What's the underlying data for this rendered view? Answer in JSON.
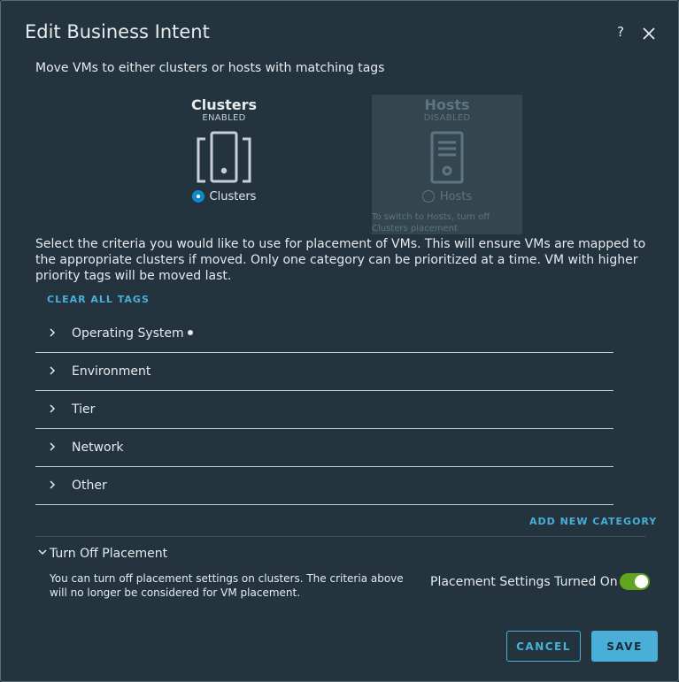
{
  "dialog": {
    "title": "Edit Business Intent",
    "help_label": "?",
    "subtitle": "Move VMs to either clusters or hosts with matching tags"
  },
  "options": {
    "clusters": {
      "name": "Clusters",
      "state": "ENABLED",
      "radio_label": "Clusters",
      "selected": true
    },
    "hosts": {
      "name": "Hosts",
      "state": "DISABLED",
      "radio_label": "Hosts",
      "selected": false,
      "hint": "To switch to Hosts, turn off Clusters placement"
    }
  },
  "criteria_description": "Select the criteria you would like to use for placement of VMs. This will ensure VMs are mapped to the appropriate clusters if moved. Only one category can be prioritized at a time. VM with higher priority tags will be moved last.",
  "clear_all_tags": "CLEAR ALL TAGS",
  "categories": [
    {
      "label": "Operating System"
    },
    {
      "label": "Environment"
    },
    {
      "label": "Tier"
    },
    {
      "label": "Network"
    },
    {
      "label": "Other"
    }
  ],
  "add_new_category": "ADD NEW CATEGORY",
  "turn_off": {
    "title": "Turn Off Placement",
    "description": "You can turn off placement settings on clusters. The criteria above will no longer be considered for VM placement.",
    "toggle_label": "Placement Settings Turned On",
    "toggle_on": true
  },
  "buttons": {
    "cancel": "CANCEL",
    "save": "SAVE"
  },
  "colors": {
    "accent": "#49afd9",
    "radio": "#0f89c8",
    "toggle_on": "#62a420",
    "background": "#23343e"
  }
}
